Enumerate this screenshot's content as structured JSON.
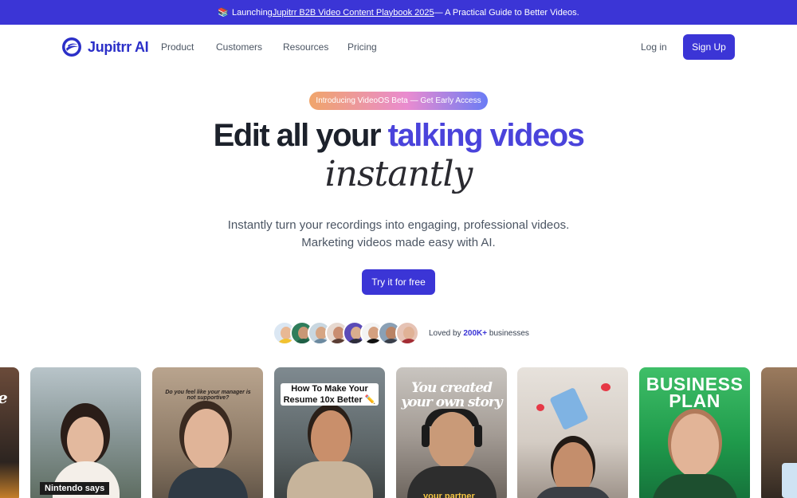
{
  "announcement": {
    "emoji": "📚",
    "prefix": "Launching ",
    "link": "Jupitrr B2B Video Content Playbook 2025",
    "suffix": "— A Practical Guide to Better Videos."
  },
  "nav": {
    "brand": "Jupitrr AI",
    "items": [
      "Product",
      "Customers",
      "Resources",
      "Pricing"
    ],
    "login": "Log in",
    "signup": "Sign Up"
  },
  "hero": {
    "pill": "Introducing VideoOS Beta — Get Early Access",
    "headline_plain": "Edit all your ",
    "headline_accent": "talking videos",
    "headline_script": "instantly",
    "sub_line1": "Instantly turn your recordings into engaging, professional videos.",
    "sub_line2": "Marketing videos made easy with AI.",
    "cta": "Try it for free"
  },
  "social_proof": {
    "prefix": "Loved by ",
    "count": "200K+",
    "suffix": " businesses"
  },
  "cards": {
    "c0_text": "e",
    "c1_text": "Nintendo says",
    "c2_text": "Do you feel like your manager is not supportive?",
    "c3_line1": "How To Make Your",
    "c3_line2": "Resume 10x Better ✏️",
    "c4_line1": "You created",
    "c4_line2": "your own story",
    "c4_bottom": "your partner",
    "c6_line1": "BUSINESS",
    "c6_line2": "PLAN"
  },
  "colors": {
    "brand": "#3b35d6",
    "accent_text": "#4a43db"
  }
}
